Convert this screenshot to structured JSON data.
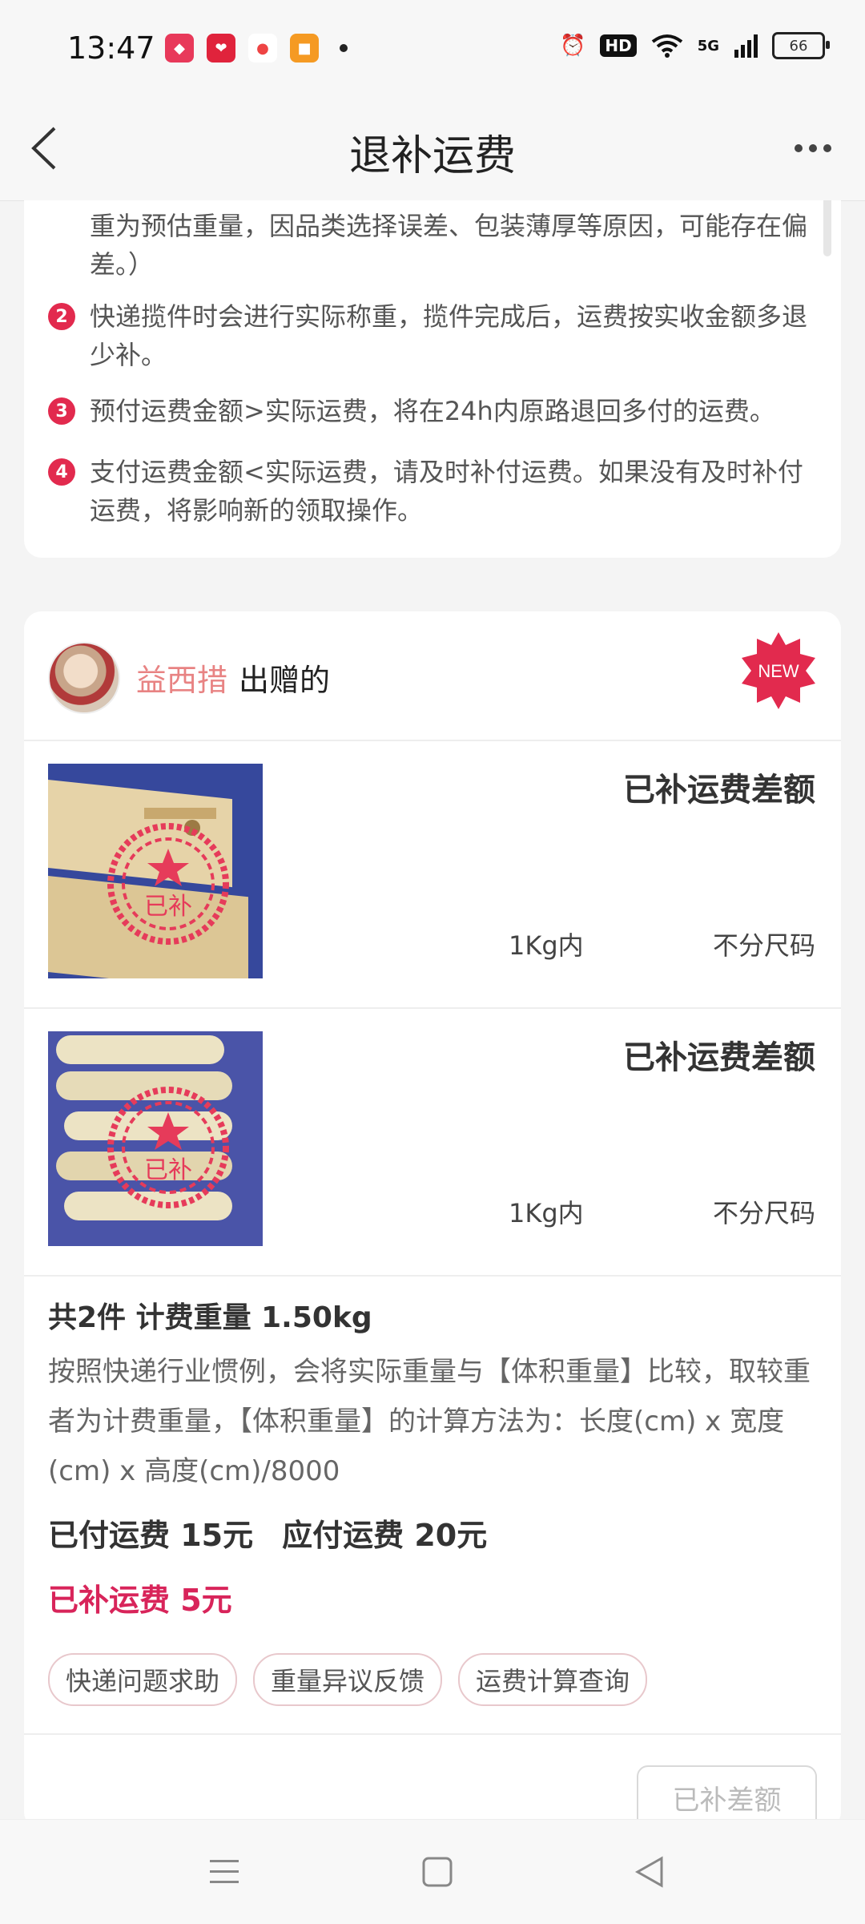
{
  "status_bar": {
    "time": "13:47",
    "network": "5G",
    "battery": "66",
    "hd": "HD"
  },
  "header": {
    "title": "退补运费"
  },
  "rules": [
    {
      "num": "",
      "text": "重为预估重量，因品类选择误差、包装薄厚等原因，可能存在偏差。）"
    },
    {
      "num": "2",
      "text": "快递揽件时会进行实际称重，揽件完成后，运费按实收金额多退少补。"
    },
    {
      "num": "3",
      "text": "预付运费金额>实际运费，将在24h内原路退回多付的运费。"
    },
    {
      "num": "4",
      "text": "支付运费金额<实际运费，请及时补付运费。如果没有及时补付运费，将影响新的领取操作。"
    }
  ],
  "order": {
    "giver_name": "益西措",
    "giver_suffix": "出赠的",
    "new_badge": "NEW",
    "items": [
      {
        "status": "已补运费差额",
        "weight": "1Kg内",
        "size": "不分尺码",
        "stamp": "已补"
      },
      {
        "status": "已补运费差额",
        "weight": "1Kg内",
        "size": "不分尺码",
        "stamp": "已补"
      }
    ],
    "summary": {
      "title": "共2件 计费重量 1.50kg",
      "description": "按照快递行业惯例，会将实际重量与【体积重量】比较，取较重者为计费重量，【体积重量】的计算方法为：长度(cm) x 宽度(cm) x 高度(cm)/8000",
      "paid": "已付运费 15元",
      "due": "应付运费 20元",
      "extra": "已补运费 5元"
    },
    "chips": [
      "快递问题求助",
      "重量异议反馈",
      "运费计算查询"
    ],
    "bottom_button": "已补差额"
  },
  "colors": {
    "accent_red": "#e22a4e",
    "extra_fee": "#d8245a",
    "giver_name": "#e88383"
  }
}
